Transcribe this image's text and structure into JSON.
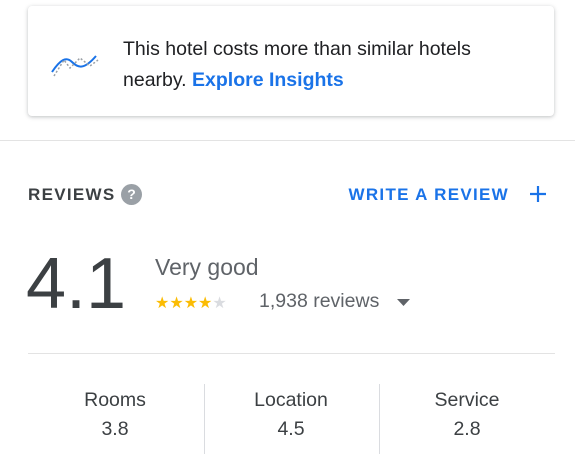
{
  "insight": {
    "icon": "price-trend-icon",
    "message": "This hotel costs more than similar hotels nearby.",
    "link_label": "Explore Insights",
    "link_color": "#1a73e8"
  },
  "reviews": {
    "heading": "REVIEWS",
    "help_icon_label": "?",
    "write_review_label": "WRITE A REVIEW",
    "overall_rating": "4.1",
    "rating_text": "Very good",
    "stars_filled": 4,
    "stars_total": 5,
    "review_count": "1,938 reviews",
    "star_color": "#fbbc04",
    "categories": [
      {
        "name": "Rooms",
        "score": "3.8"
      },
      {
        "name": "Location",
        "score": "4.5"
      },
      {
        "name": "Service",
        "score": "2.8"
      }
    ]
  }
}
